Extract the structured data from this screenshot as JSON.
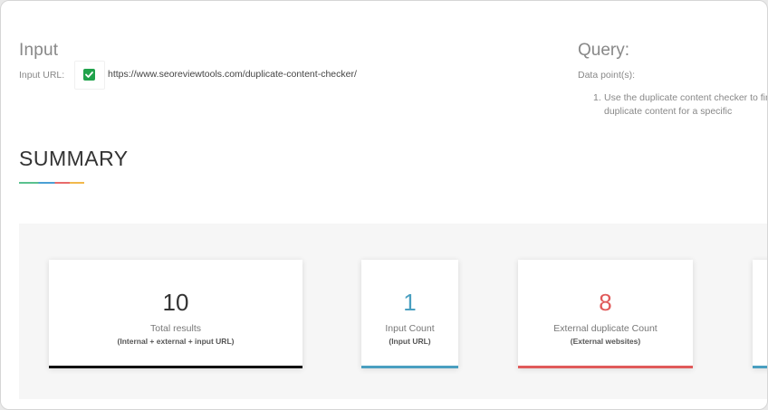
{
  "input": {
    "title": "Input",
    "url_label": "Input URL:",
    "url_value": "https://www.seoreviewtools.com/duplicate-content-checker/",
    "checked": true
  },
  "query": {
    "title": "Query:",
    "datapoints_label": "Data point(s):",
    "items": [
      {
        "number": "1.",
        "line1": "Use the duplicate content checker to find",
        "line2": "duplicate content for a specific"
      }
    ]
  },
  "summary": {
    "title": "SUMMARY",
    "underline_colors": [
      "#5ac18e",
      "#4a9fd4",
      "#e86b6b",
      "#f2b84b"
    ],
    "cards": [
      {
        "value": "10",
        "label": "Total results",
        "sub": "(Internal + external + input URL)",
        "color": "#333333",
        "bar_color": "#111111"
      },
      {
        "value": "1",
        "label": "Input Count",
        "sub": "(Input URL)",
        "color": "#4a9fc0",
        "bar_color": "#4a9fc0"
      },
      {
        "value": "8",
        "label": "External duplicate Count",
        "sub": "(External websites)",
        "color": "#e05a5a",
        "bar_color": "#e05a5a"
      },
      {
        "value": "",
        "label": "",
        "sub": "",
        "color": "#4a9fc0",
        "bar_color": "#4a9fc0"
      }
    ]
  }
}
